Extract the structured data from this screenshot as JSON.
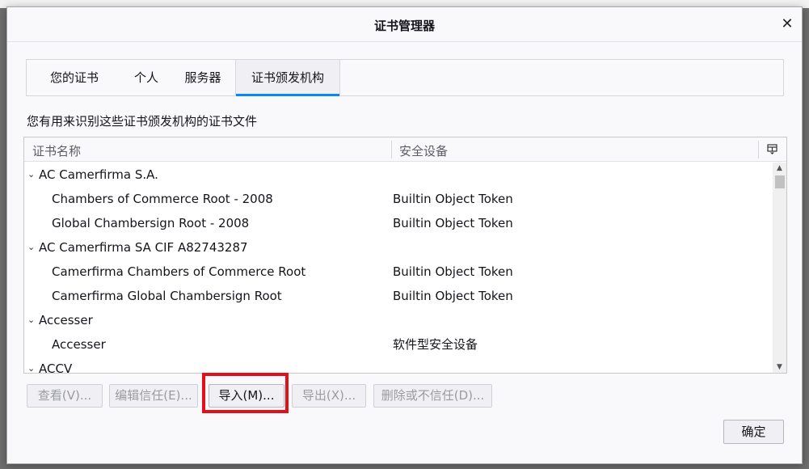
{
  "window": {
    "title": "证书管理器",
    "close_icon": "close-icon"
  },
  "tabs": [
    {
      "label": "您的证书"
    },
    {
      "label": "个人"
    },
    {
      "label": "服务器"
    },
    {
      "label": "证书颁发机构",
      "selected": true
    }
  ],
  "description": "您有用来识别这些证书颁发机构的证书文件",
  "tree": {
    "columns": [
      "证书名称",
      "安全设备"
    ],
    "rows": [
      {
        "type": "group",
        "name": "AC Camerfirma S.A.",
        "device": ""
      },
      {
        "type": "child",
        "name": "Chambers of Commerce Root - 2008",
        "device": "Builtin Object Token"
      },
      {
        "type": "child",
        "name": "Global Chambersign Root - 2008",
        "device": "Builtin Object Token"
      },
      {
        "type": "group",
        "name": "AC Camerfirma SA CIF A82743287",
        "device": ""
      },
      {
        "type": "child",
        "name": "Camerfirma Chambers of Commerce Root",
        "device": "Builtin Object Token"
      },
      {
        "type": "child",
        "name": "Camerfirma Global Chambersign Root",
        "device": "Builtin Object Token"
      },
      {
        "type": "group",
        "name": "Accesser",
        "device": ""
      },
      {
        "type": "child",
        "name": "Accesser",
        "device": "软件型安全设备"
      },
      {
        "type": "group",
        "name": "ACCV",
        "device": ""
      }
    ]
  },
  "buttons": {
    "view": "查看(V)...",
    "edit_trust": "编辑信任(E)...",
    "import": "导入(M)...",
    "export": "导出(X)...",
    "delete": "删除或不信任(D)...",
    "ok": "确定"
  },
  "colors": {
    "accent": "#0a84ff",
    "highlight": "#e3101b"
  }
}
